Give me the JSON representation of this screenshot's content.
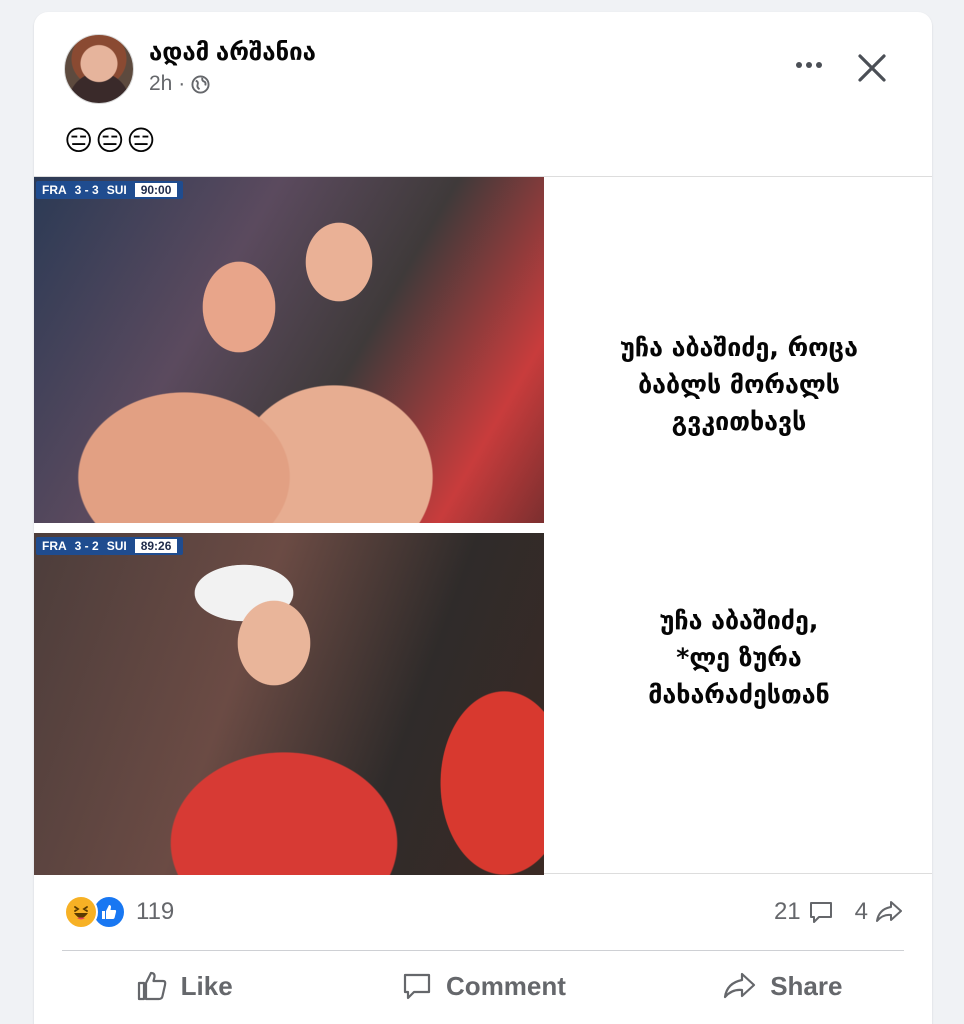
{
  "post": {
    "author": "ადამ არშანია",
    "time": "2h ·",
    "text": "😑😑😑"
  },
  "meme": {
    "scoreboard_top": {
      "team1": "FRA",
      "score": "3 - 3",
      "team2": "SUI",
      "clock": "90:00"
    },
    "scoreboard_bottom": {
      "team1": "FRA",
      "score": "3 - 2",
      "team2": "SUI",
      "clock": "89:26"
    },
    "caption_top": "უჩა აბაშიძე, როცა\nბაბლს მორალს\nგვკითხავს",
    "caption_bottom": "უჩა აბაშიძე,\n*ლე ზურა\nმახარაძესთან"
  },
  "stats": {
    "reaction_count": "119",
    "comment_count": "21",
    "share_count": "4"
  },
  "actions": {
    "like": "Like",
    "comment": "Comment",
    "share": "Share"
  },
  "icons": [
    "more-icon",
    "close-icon",
    "globe-icon",
    "haha-reaction-icon",
    "like-reaction-icon",
    "comment-icon",
    "share-icon",
    "like-icon"
  ],
  "colors": {
    "background": "#f0f2f5",
    "card": "#ffffff",
    "secondary_text": "#65676b",
    "like_blue": "#1877f2",
    "haha_yellow": "#f7b125"
  }
}
